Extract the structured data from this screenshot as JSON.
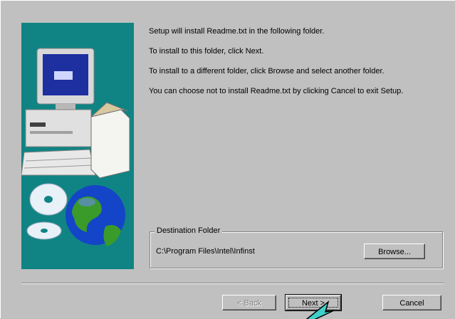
{
  "intro": {
    "line1": "Setup will install Readme.txt in the following folder.",
    "line2": "To install to this folder, click Next.",
    "line3": "To install to a different folder, click Browse and select another folder.",
    "line4": "You can choose not to install Readme.txt by clicking Cancel to exit Setup."
  },
  "destination": {
    "group_label": "Destination Folder",
    "path": "C:\\Program Files\\Intel\\Infinst",
    "browse_label": "Browse..."
  },
  "buttons": {
    "back_label": "< Back",
    "next_label": "Next >",
    "cancel_label": "Cancel"
  },
  "colors": {
    "side_panel": "#108484",
    "dialog_face": "#c0c0c0",
    "pointer": "#3fd0c8"
  },
  "icons": {
    "side_panel": "computer-and-globe-illustration",
    "pointer": "mouse-pointer-arrow"
  }
}
